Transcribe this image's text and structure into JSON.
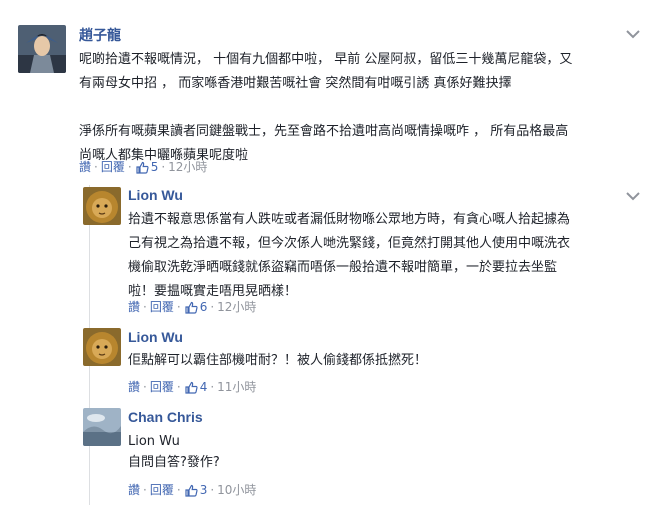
{
  "comments": [
    {
      "author": "趙子龍",
      "text": "呢啲拾遺不報嘅情況， 十個有九個都中啦， 早前 公屋阿叔，留低三十幾萬尼龍袋，又\n有兩母女中招 ， 而家喺香港咁艱苦嘅社會 突然間有咁嘅引誘 真係好難抉擇\n\n淨係所有嘅蘋果讀者同鍵盤戰士，先至會路不拾遺咁高尚嘅情操嘅咋 ， 所有品格最高\n尚嘅人都集中曬喺蘋果呢度啦",
      "actions": {
        "like": "讚",
        "reply": "回覆",
        "likes": "5",
        "time": "12小時"
      }
    },
    {
      "author": "Lion Wu",
      "text": "拾遺不報意思係當有人跌咗或者漏低財物喺公眾地方時，有貪心嘅人拾起據為\n己有視之為拾遺不報，但今次係人哋洗緊錢，佢竟然打開其他人使用中嘅洗衣\n機偷取洗乾淨晒嘅錢就係盜竊而唔係一般拾遺不報咁簡單，一於要拉去坐監\n啦！要揾嘅實走唔甩晃晒樣！",
      "actions": {
        "like": "讚",
        "reply": "回覆",
        "likes": "6",
        "time": "12小時"
      }
    },
    {
      "author": "Lion Wu",
      "text": "佢點解可以霸住部機咁耐？！被人偷錢都係抵撚死！",
      "actions": {
        "like": "讚",
        "reply": "回覆",
        "likes": "4",
        "time": "11小時"
      }
    },
    {
      "author": "Chan Chris",
      "text": "Lion Wu\n自問自答?發作?",
      "actions": {
        "like": "讚",
        "reply": "回覆",
        "likes": "3",
        "time": "10小時"
      }
    }
  ],
  "colors": {
    "link": "#365899",
    "action": "#4267b2",
    "meta": "#90949c",
    "like_icon": "#4267b2"
  },
  "icons": {
    "like": "thumbs-up-icon",
    "options": "chevron-down-icon"
  }
}
